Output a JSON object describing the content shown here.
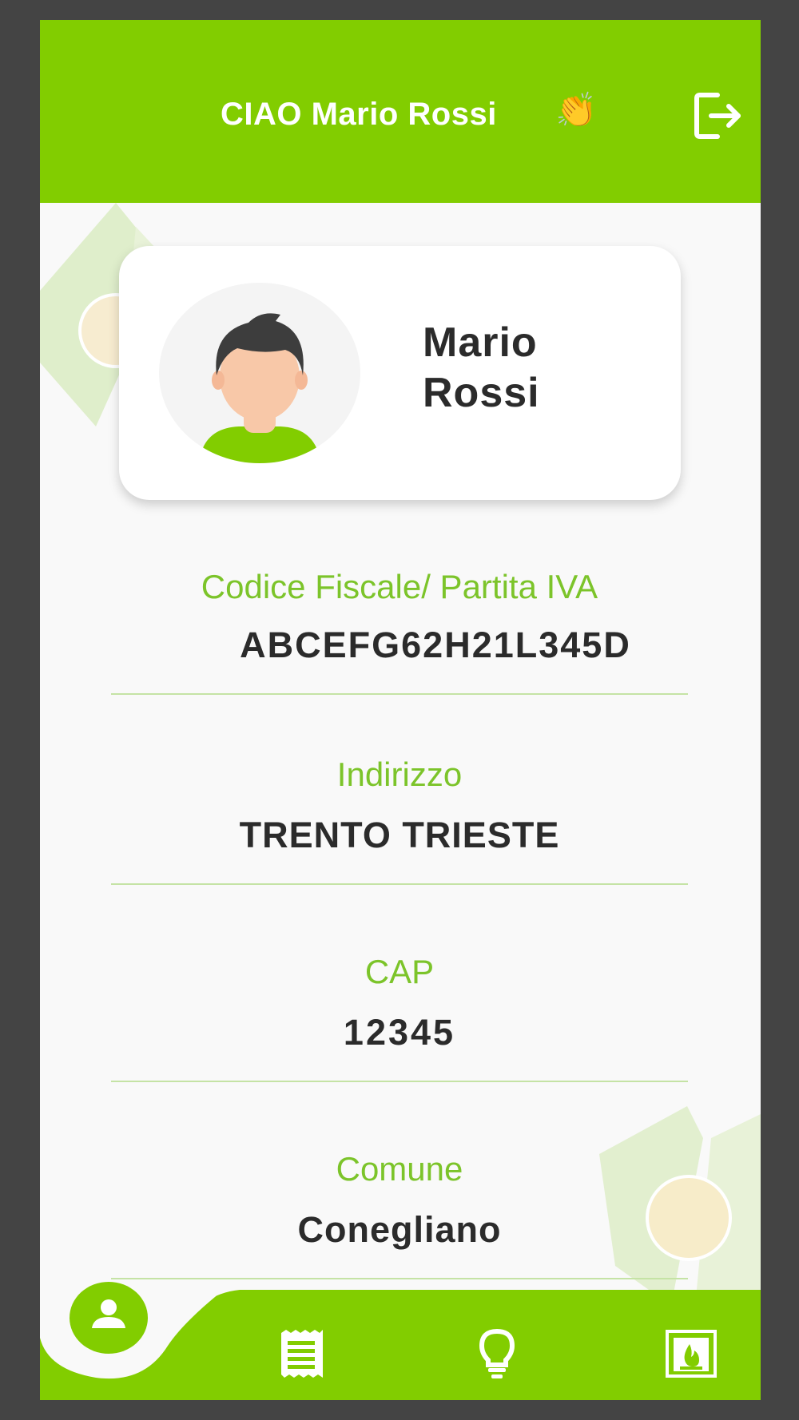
{
  "header": {
    "greeting": "CIAO Mario Rossi",
    "wave_emoji": "👏",
    "logout_icon": "logout-icon"
  },
  "profile": {
    "name_first": "Mario",
    "name_last": "Rossi",
    "avatar_icon": "user-avatar"
  },
  "fields": [
    {
      "label": "Codice Fiscale/ Partita IVA",
      "value": "ABCEFG62H21L345D"
    },
    {
      "label": "Indirizzo",
      "value": "TRENTO TRIESTE"
    },
    {
      "label": "CAP",
      "value": "12345"
    },
    {
      "label": "Comune",
      "value": "Conegliano"
    }
  ],
  "bottom_nav": {
    "items": [
      {
        "icon": "profile-icon",
        "active": true
      },
      {
        "icon": "receipt-icon",
        "active": false
      },
      {
        "icon": "lightbulb-icon",
        "active": false
      },
      {
        "icon": "fireplace-icon",
        "active": false
      }
    ]
  },
  "colors": {
    "accent": "#82cd00",
    "label": "#7cc42a",
    "text": "#2b2b2b",
    "background": "#f9f9f9",
    "frame": "#444444"
  }
}
